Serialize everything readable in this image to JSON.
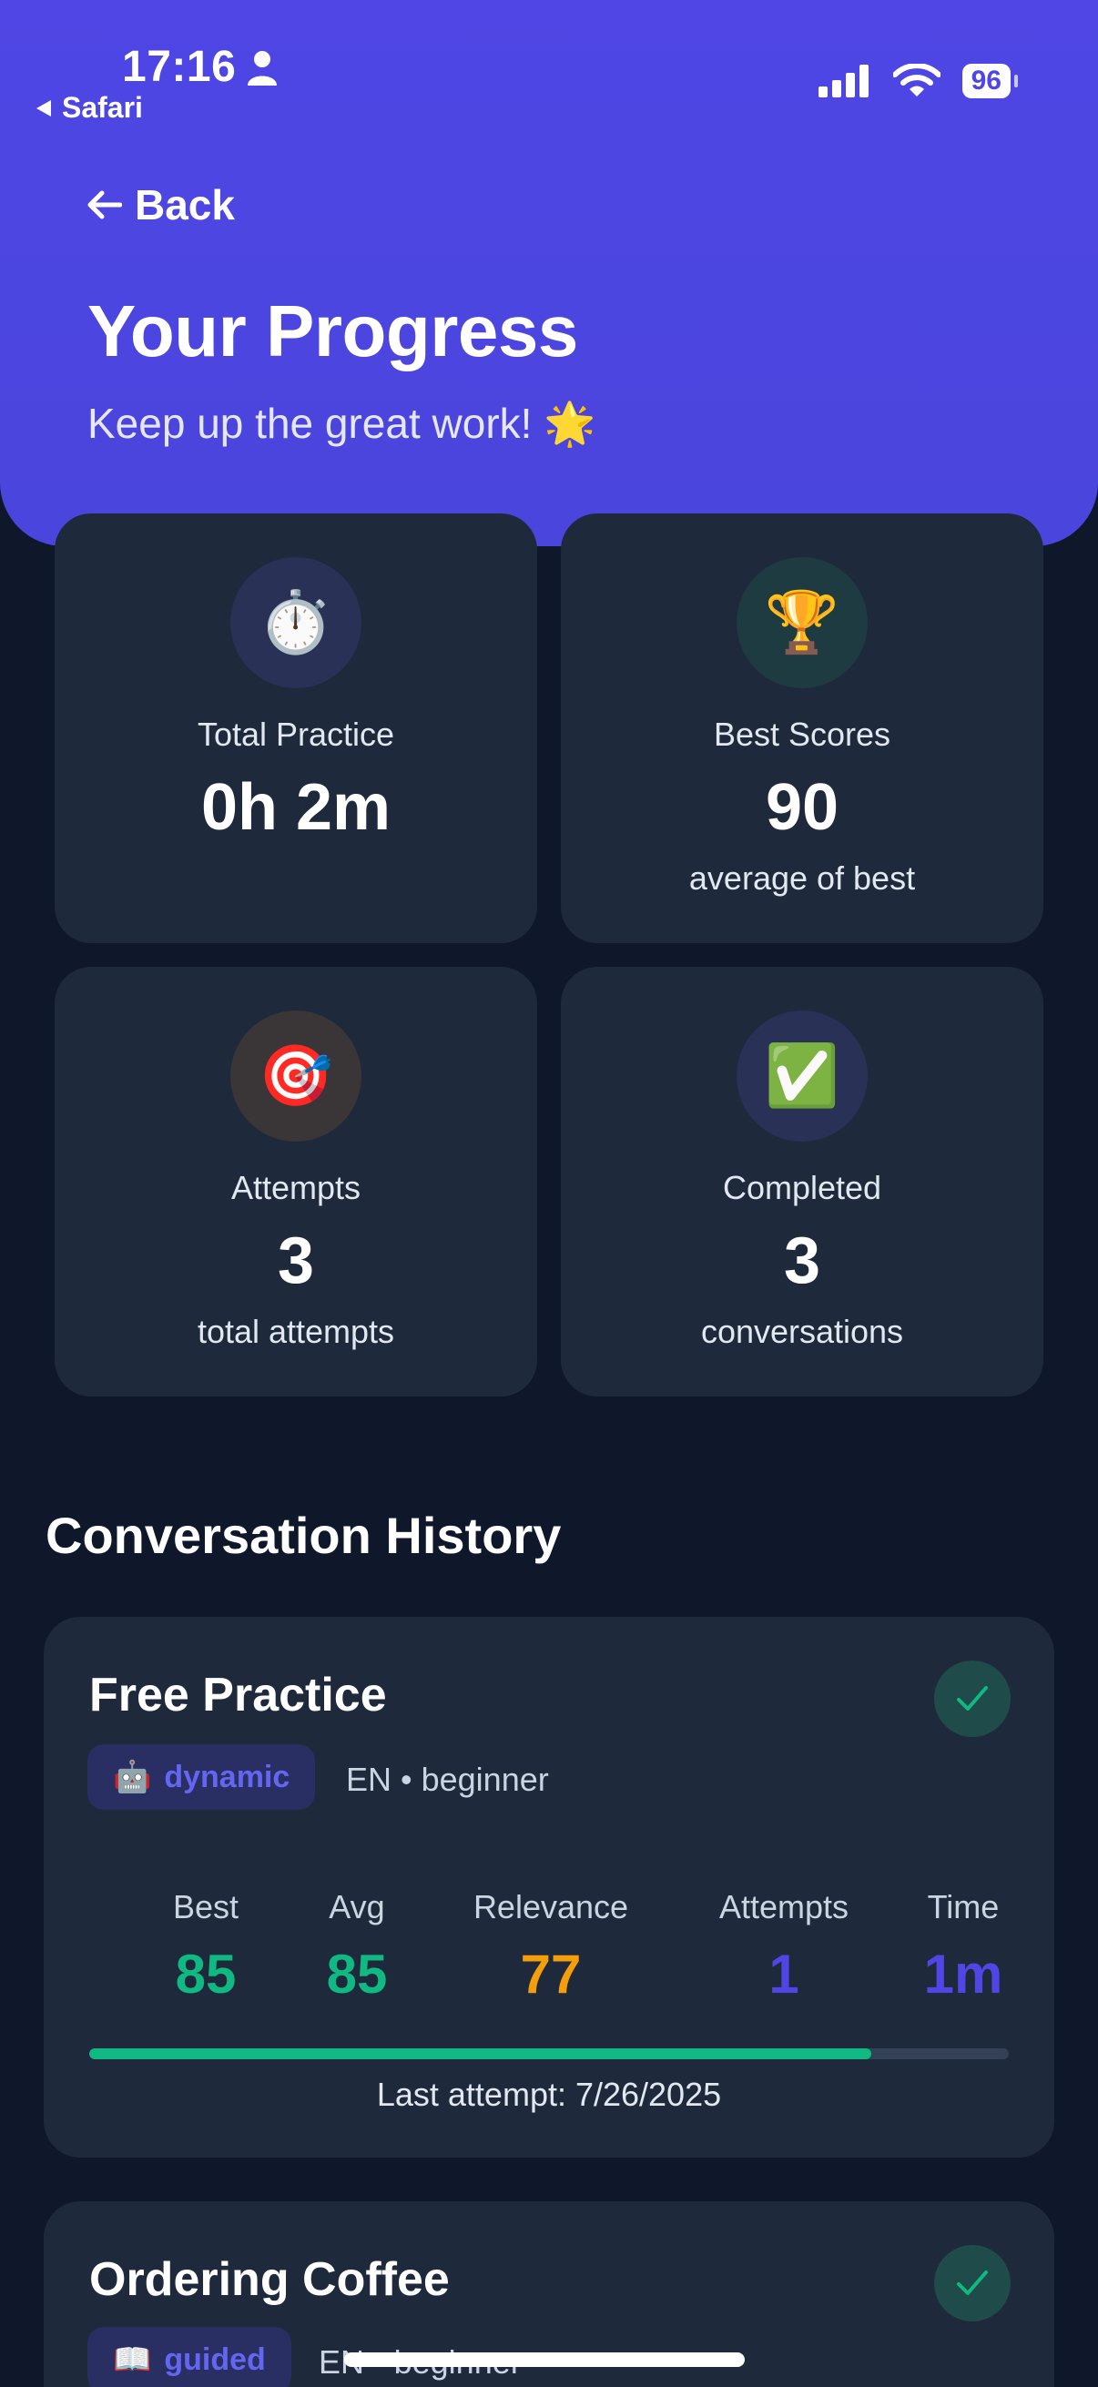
{
  "status_bar": {
    "time": "17:16",
    "back_app": "Safari",
    "battery": "96"
  },
  "header": {
    "back_label": "Back",
    "title": "Your Progress",
    "subtitle": "Keep up the great work! 🌟"
  },
  "stats": [
    {
      "icon": "⏱️",
      "icon_name": "stopwatch-icon",
      "label": "Total Practice",
      "value": "0h 2m",
      "sub": "",
      "icon_bg": "#2a3157"
    },
    {
      "icon": "🏆",
      "icon_name": "trophy-icon",
      "label": "Best Scores",
      "value": "90",
      "sub": "average of best",
      "icon_bg": "#1f3b42"
    },
    {
      "icon": "🎯",
      "icon_name": "target-icon",
      "label": "Attempts",
      "value": "3",
      "sub": "total attempts",
      "icon_bg": "#3a3537"
    },
    {
      "icon": "✅",
      "icon_name": "check-mark-icon",
      "label": "Completed",
      "value": "3",
      "sub": "conversations",
      "icon_bg": "#2a3157"
    }
  ],
  "history": {
    "title": "Conversation History",
    "items": [
      {
        "title": "Free Practice",
        "mode_icon": "🤖",
        "mode": "dynamic",
        "meta": "EN • beginner",
        "metrics": [
          {
            "label": "Best",
            "value": "85",
            "color": "#10b981"
          },
          {
            "label": "Avg",
            "value": "85",
            "color": "#10b981"
          },
          {
            "label": "Relevance",
            "value": "77",
            "color": "#f59e0b"
          },
          {
            "label": "Attempts",
            "value": "1",
            "color": "#4f46e5"
          },
          {
            "label": "Time",
            "value": "1m",
            "color": "#4f46e5"
          }
        ],
        "progress": 0.85,
        "last_attempt": "Last attempt: 7/26/2025"
      },
      {
        "title": "Ordering Coffee",
        "mode_icon": "📖",
        "mode": "guided",
        "meta": "EN • beginner"
      }
    ]
  }
}
